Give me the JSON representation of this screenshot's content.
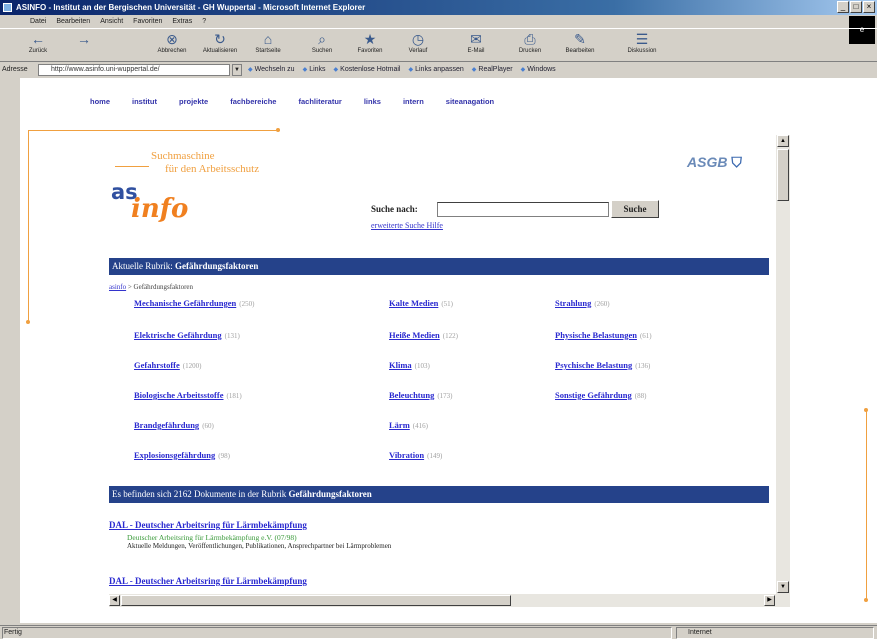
{
  "window": {
    "title": "ASINFO - Institut an der Bergischen Universität - GH Wuppertal - Microsoft Internet Explorer",
    "controls": [
      "_",
      "□",
      "×"
    ]
  },
  "menu": [
    "Datei",
    "Bearbeiten",
    "Ansicht",
    "Favoriten",
    "Extras",
    "?"
  ],
  "toolbar": [
    {
      "label": "Zurück",
      "glyph": "←"
    },
    {
      "label": "",
      "glyph": "→"
    },
    {
      "label": "Abbrechen",
      "glyph": "⊗"
    },
    {
      "label": "Aktualisieren",
      "glyph": "↻"
    },
    {
      "label": "Startseite",
      "glyph": "⌂"
    },
    {
      "label": "Suchen",
      "glyph": "⌕"
    },
    {
      "label": "Favoriten",
      "glyph": "★"
    },
    {
      "label": "Verlauf",
      "glyph": "◷"
    },
    {
      "label": "E-Mail",
      "glyph": "✉"
    },
    {
      "label": "Drucken",
      "glyph": "⎙"
    },
    {
      "label": "Bearbeiten",
      "glyph": "✎"
    },
    {
      "label": "Diskussion",
      "glyph": "☰"
    }
  ],
  "address": {
    "label": "Adresse",
    "url": "http://www.asinfo.uni-wuppertal.de/",
    "go": "▼",
    "links": [
      "Wechseln zu",
      "Links",
      "Kostenlose Hotmail",
      "Links anpassen",
      "RealPlayer",
      "Windows"
    ]
  },
  "nav": [
    "home",
    "institut",
    "projekte",
    "fachbereiche",
    "fachliteratur",
    "links",
    "intern",
    "siteanagation"
  ],
  "headline": {
    "line1": "Suchmaschine",
    "line2": "für den Arbeitsschutz"
  },
  "logos": {
    "asinfo_as": "as",
    "asinfo_info": "info",
    "asgb": "ASGB",
    "asgb_shield": "⛉"
  },
  "search": {
    "label": "Suche nach:",
    "value": "",
    "button": "Suche",
    "sublinks": "erweiterte Suche  Hilfe"
  },
  "rubric_bar": {
    "prefix": "Aktuelle Rubrik: ",
    "name": "Gefährdungsfaktoren"
  },
  "breadcrumb": {
    "link": "asinfo",
    "rest": " > Gefährdungsfaktoren"
  },
  "categories": [
    {
      "name": "Mechanische Gefährdungen",
      "count": "(250)"
    },
    {
      "name": "Kalte Medien",
      "count": "(51)"
    },
    {
      "name": "Strahlung",
      "count": "(260)"
    },
    {
      "name": "Elektrische Gefährdung",
      "count": "(131)"
    },
    {
      "name": "Heiße Medien",
      "count": "(122)"
    },
    {
      "name": "Physische Belastungen",
      "count": "(61)"
    },
    {
      "name": "Gefahrstoffe",
      "count": "(1200)"
    },
    {
      "name": "Klima",
      "count": "(103)"
    },
    {
      "name": "Psychische Belastung",
      "count": "(136)"
    },
    {
      "name": "Biologische Arbeitsstoffe",
      "count": "(181)"
    },
    {
      "name": "Beleuchtung",
      "count": "(173)"
    },
    {
      "name": "Sonstige Gefährdung",
      "count": "(88)"
    },
    {
      "name": "Brandgefährdung",
      "count": "(60)"
    },
    {
      "name": "Lärm",
      "count": "(416)"
    },
    {
      "name": "Explosionsgefährdung",
      "count": "(98)"
    },
    {
      "name": "Vibration",
      "count": "(149)"
    }
  ],
  "results_bar": {
    "prefix": "Es befinden sich 2162 Dokumente in der Rubrik ",
    "name": "Gefährdungsfaktoren"
  },
  "results": [
    {
      "title": "DAL - Deutscher Arbeitsring für Lärmbekämpfung",
      "url": "Deutscher Arbeitsring für Lärmbekämpfung e.V.   (07/98)",
      "desc": "Aktuelle Meldungen, Veröffentlichungen, Publikationen, Ansprechpartner bei Lärmproblemen"
    },
    {
      "title": "DAL - Deutscher Arbeitsring für Lärmbekämpfung",
      "url": "",
      "desc": ""
    }
  ],
  "status": {
    "left": "Fertig",
    "right": "Internet"
  }
}
